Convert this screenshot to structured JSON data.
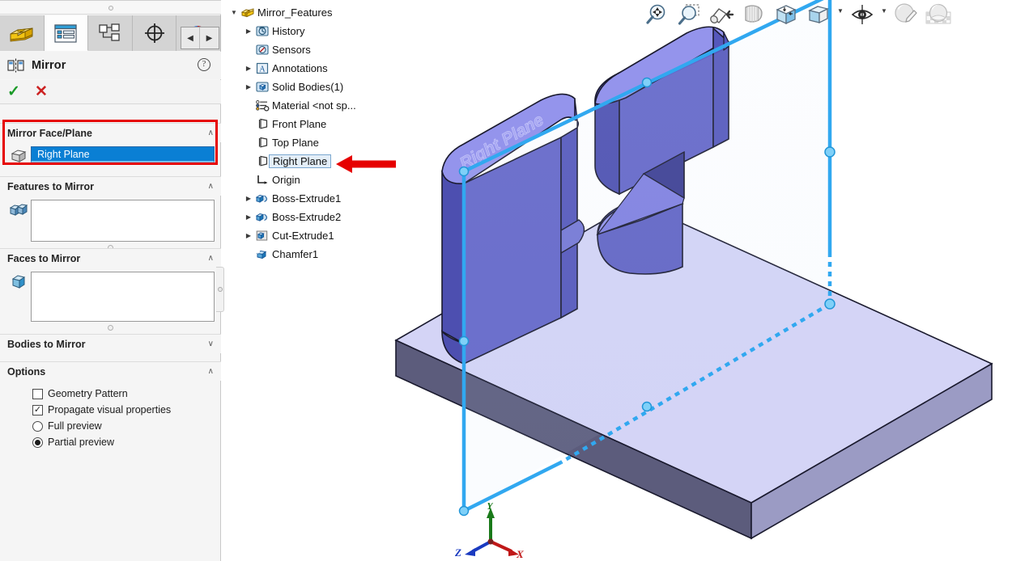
{
  "panel": {
    "tabs": [
      {
        "name": "feature-manager-tab",
        "icon": "yellow-block-icon",
        "active": false
      },
      {
        "name": "property-manager-tab",
        "icon": "property-list-icon",
        "active": true
      },
      {
        "name": "configuration-manager-tab",
        "icon": "configuration-tree-icon",
        "active": false
      },
      {
        "name": "dimxpert-manager-tab",
        "icon": "crosshair-icon",
        "active": false
      },
      {
        "name": "display-manager-tab",
        "icon": "appearance-sphere-icon",
        "active": false
      }
    ],
    "nav_prev": "◀",
    "nav_next": "▶",
    "title": "Mirror",
    "title_icon": "mirror-icon",
    "help_label": "?",
    "ok_label": "✓",
    "cancel_label": "✕",
    "sections": {
      "mirror_face_plane": {
        "label": "Mirror Face/Plane",
        "chevron": "∧",
        "icon": "plane-cube-icon",
        "value": "Right Plane"
      },
      "features_to_mirror": {
        "label": "Features to Mirror",
        "chevron": "∧",
        "icon": "features-icon",
        "value": ""
      },
      "faces_to_mirror": {
        "label": "Faces to Mirror",
        "chevron": "∧",
        "icon": "face-cube-icon",
        "value": ""
      },
      "bodies_to_mirror": {
        "label": "Bodies to Mirror",
        "chevron": "∨"
      },
      "options": {
        "label": "Options",
        "chevron": "∧",
        "items": [
          {
            "name": "geometry-pattern",
            "label": "Geometry Pattern",
            "type": "checkbox",
            "checked": false
          },
          {
            "name": "propagate-visual-properties",
            "label": "Propagate visual properties",
            "type": "checkbox",
            "checked": true
          },
          {
            "name": "full-preview",
            "label": "Full preview",
            "type": "radio",
            "checked": false
          },
          {
            "name": "partial-preview",
            "label": "Partial preview",
            "type": "radio",
            "checked": true
          }
        ]
      }
    }
  },
  "tree": {
    "nodes": [
      {
        "label": "Mirror_Features",
        "indent": 0,
        "expander": "▼",
        "icon": "part-icon",
        "selected": false
      },
      {
        "label": "History",
        "indent": 1,
        "expander": "▶",
        "icon": "history-icon",
        "selected": false
      },
      {
        "label": "Sensors",
        "indent": 1,
        "expander": "",
        "icon": "sensors-icon",
        "selected": false
      },
      {
        "label": "Annotations",
        "indent": 1,
        "expander": "▶",
        "icon": "annotations-icon",
        "selected": false
      },
      {
        "label": "Solid Bodies(1)",
        "indent": 1,
        "expander": "▶",
        "icon": "solid-bodies-icon",
        "selected": false
      },
      {
        "label": "Material <not sp...",
        "indent": 1,
        "expander": "",
        "icon": "material-icon",
        "selected": false
      },
      {
        "label": "Front Plane",
        "indent": 1,
        "expander": "",
        "icon": "plane-icon",
        "selected": false
      },
      {
        "label": "Top Plane",
        "indent": 1,
        "expander": "",
        "icon": "plane-icon",
        "selected": false
      },
      {
        "label": "Right Plane",
        "indent": 1,
        "expander": "",
        "icon": "plane-icon",
        "selected": true
      },
      {
        "label": "Origin",
        "indent": 1,
        "expander": "",
        "icon": "origin-icon",
        "selected": false
      },
      {
        "label": "Boss-Extrude1",
        "indent": 1,
        "expander": "▶",
        "icon": "boss-extrude-icon",
        "selected": false
      },
      {
        "label": "Boss-Extrude2",
        "indent": 1,
        "expander": "▶",
        "icon": "boss-extrude-icon",
        "selected": false
      },
      {
        "label": "Cut-Extrude1",
        "indent": 1,
        "expander": "▶",
        "icon": "cut-extrude-icon",
        "selected": false
      },
      {
        "label": "Chamfer1",
        "indent": 1,
        "expander": "",
        "icon": "chamfer-icon",
        "selected": false
      }
    ]
  },
  "viewport": {
    "toolbar": [
      {
        "name": "zoom-to-fit-icon",
        "caret": false
      },
      {
        "name": "zoom-to-area-icon",
        "caret": false
      },
      {
        "name": "previous-view-icon",
        "caret": false
      },
      {
        "name": "section-view-icon",
        "caret": false
      },
      {
        "name": "view-orientation-icon",
        "caret": false
      },
      {
        "name": "display-style-icon",
        "caret": true
      },
      {
        "name": "hide-show-items-icon",
        "caret": true
      },
      {
        "name": "edit-appearance-icon",
        "caret": false
      },
      {
        "name": "apply-scene-icon",
        "caret": false
      }
    ],
    "plane_label": "Right Plane",
    "triad": {
      "x": "X",
      "y": "Y",
      "z": "Z"
    }
  },
  "colors": {
    "selection_blue": "#0a7fd4",
    "plane_line": "#31a8f0",
    "model_top": "#9494ec",
    "model_side": "#6466c8",
    "model_dark": "#4a4aa8",
    "plate_top": "#d4d4f6",
    "plate_front": "#5c5c7c",
    "plate_right": "#9b9bc4",
    "callout_red": "#e60000",
    "tree_selection": "#e3eef8"
  }
}
